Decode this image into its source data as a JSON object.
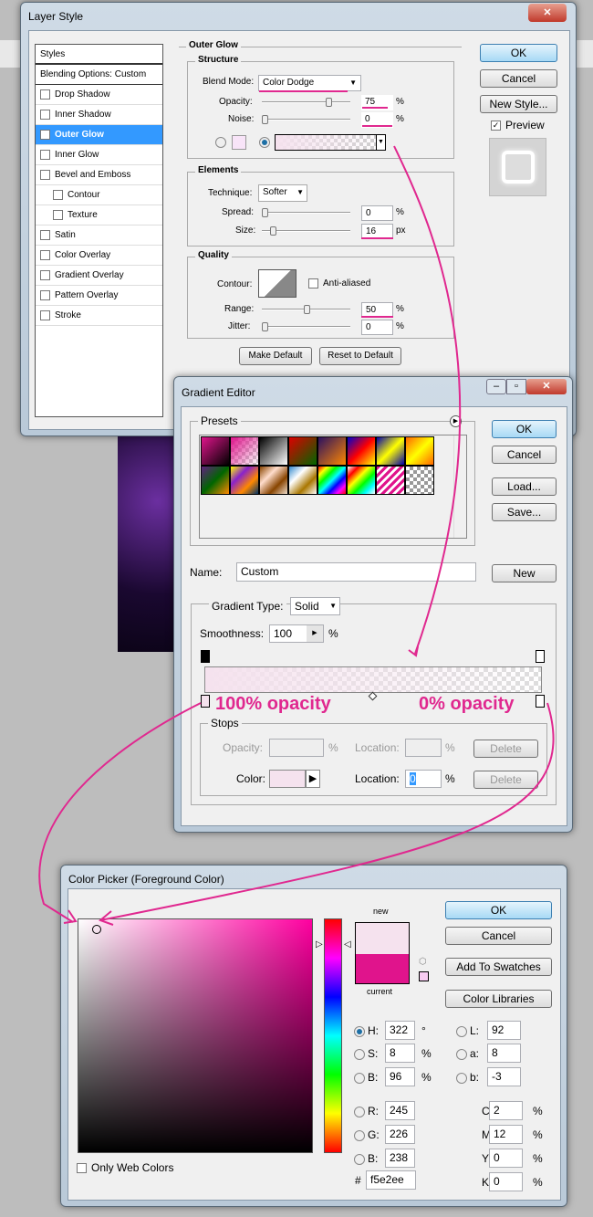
{
  "layer_style": {
    "title": "Layer Style",
    "styles_header": "Styles",
    "blending": "Blending Options: Custom",
    "items": [
      {
        "label": "Drop Shadow",
        "checked": false
      },
      {
        "label": "Inner Shadow",
        "checked": false
      },
      {
        "label": "Outer Glow",
        "checked": true
      },
      {
        "label": "Inner Glow",
        "checked": false
      },
      {
        "label": "Bevel and Emboss",
        "checked": false
      },
      {
        "label": "Contour",
        "checked": false
      },
      {
        "label": "Texture",
        "checked": false
      },
      {
        "label": "Satin",
        "checked": false
      },
      {
        "label": "Color Overlay",
        "checked": false
      },
      {
        "label": "Gradient Overlay",
        "checked": false
      },
      {
        "label": "Pattern Overlay",
        "checked": false
      },
      {
        "label": "Stroke",
        "checked": false
      }
    ],
    "outer_glow": "Outer Glow",
    "structure": "Structure",
    "blend_mode_label": "Blend Mode:",
    "blend_mode": "Color Dodge",
    "opacity_label": "Opacity:",
    "opacity": "75",
    "noise_label": "Noise:",
    "noise": "0",
    "pct": "%",
    "px": "px",
    "elements": "Elements",
    "technique_label": "Technique:",
    "technique": "Softer",
    "spread_label": "Spread:",
    "spread": "0",
    "size_label": "Size:",
    "size": "16",
    "quality": "Quality",
    "contour_label": "Contour:",
    "anti_aliased": "Anti-aliased",
    "range_label": "Range:",
    "range": "50",
    "jitter_label": "Jitter:",
    "jitter": "0",
    "make_default": "Make Default",
    "reset_default": "Reset to Default",
    "ok": "OK",
    "cancel": "Cancel",
    "new_style": "New Style...",
    "preview": "Preview"
  },
  "gradient_editor": {
    "title": "Gradient Editor",
    "presets": "Presets",
    "ok": "OK",
    "cancel": "Cancel",
    "load": "Load...",
    "save": "Save...",
    "name_label": "Name:",
    "name": "Custom",
    "new": "New",
    "type_label": "Gradient Type:",
    "type": "Solid",
    "smooth_label": "Smoothness:",
    "smoothness": "100",
    "pct": "%",
    "stops": "Stops",
    "opacity_label": "Opacity:",
    "location_label": "Location:",
    "delete": "Delete",
    "color_label": "Color:",
    "location": "0",
    "annot_left": "100% opacity",
    "annot_right": "0% opacity"
  },
  "color_picker": {
    "title": "Color Picker (Foreground Color)",
    "new": "new",
    "current": "current",
    "ok": "OK",
    "cancel": "Cancel",
    "add_swatches": "Add To Swatches",
    "color_libraries": "Color Libraries",
    "only_web": "Only Web Colors",
    "fields": {
      "H": "322",
      "S": "8",
      "B": "96",
      "R": "245",
      "G": "226",
      "Bl": "238",
      "L": "92",
      "a": "8",
      "b": "-3",
      "C": "2",
      "M": "12",
      "Y": "0",
      "K": "0"
    },
    "hex": "f5e2ee",
    "hash": "#",
    "deg": "°",
    "pct": "%",
    "new_color": "#f5e2ee",
    "current_color": "#e0148c"
  }
}
